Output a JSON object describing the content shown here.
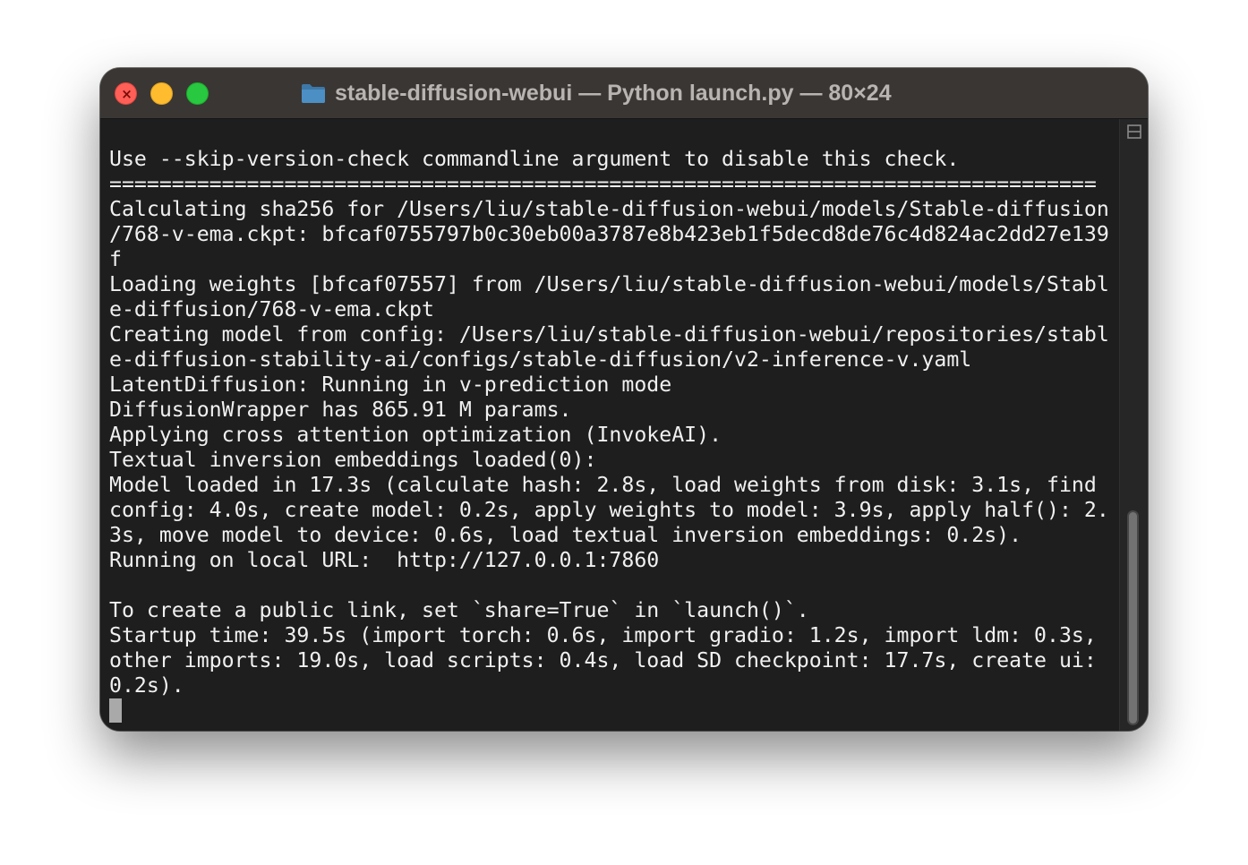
{
  "window": {
    "title": "stable-diffusion-webui — Python launch.py — 80×24",
    "folder_icon": "folder-icon",
    "close_symbol": "×"
  },
  "colors": {
    "close": "#fe5f57",
    "minimize": "#febc2e",
    "zoom": "#28c840",
    "folder": "#4b8fc4",
    "titlebar": "#3a3634",
    "terminal_bg": "#1e1e1e",
    "text": "#f0f0f0"
  },
  "terminal": {
    "lines": [
      "Use --skip-version-check commandline argument to disable this check.",
      "===============================================================================",
      "Calculating sha256 for /Users/liu/stable-diffusion-webui/models/Stable-diffusion",
      "/768-v-ema.ckpt: bfcaf0755797b0c30eb00a3787e8b423eb1f5decd8de76c4d824ac2dd27e139",
      "f",
      "Loading weights [bfcaf07557] from /Users/liu/stable-diffusion-webui/models/Stabl",
      "e-diffusion/768-v-ema.ckpt",
      "Creating model from config: /Users/liu/stable-diffusion-webui/repositories/stabl",
      "e-diffusion-stability-ai/configs/stable-diffusion/v2-inference-v.yaml",
      "LatentDiffusion: Running in v-prediction mode",
      "DiffusionWrapper has 865.91 M params.",
      "Applying cross attention optimization (InvokeAI).",
      "Textual inversion embeddings loaded(0):",
      "Model loaded in 17.3s (calculate hash: 2.8s, load weights from disk: 3.1s, find",
      "config: 4.0s, create model: 0.2s, apply weights to model: 3.9s, apply half(): 2.",
      "3s, move model to device: 0.6s, load textual inversion embeddings: 0.2s).",
      "Running on local URL:  http://127.0.0.1:7860",
      "",
      "To create a public link, set `share=True` in `launch()`.",
      "Startup time: 39.5s (import torch: 0.6s, import gradio: 1.2s, import ldm: 0.3s,",
      "other imports: 19.0s, load scripts: 0.4s, load SD checkpoint: 17.7s, create ui:",
      "0.2s)."
    ]
  },
  "scrollbar": {
    "split_icon": "split-pane-icon"
  }
}
